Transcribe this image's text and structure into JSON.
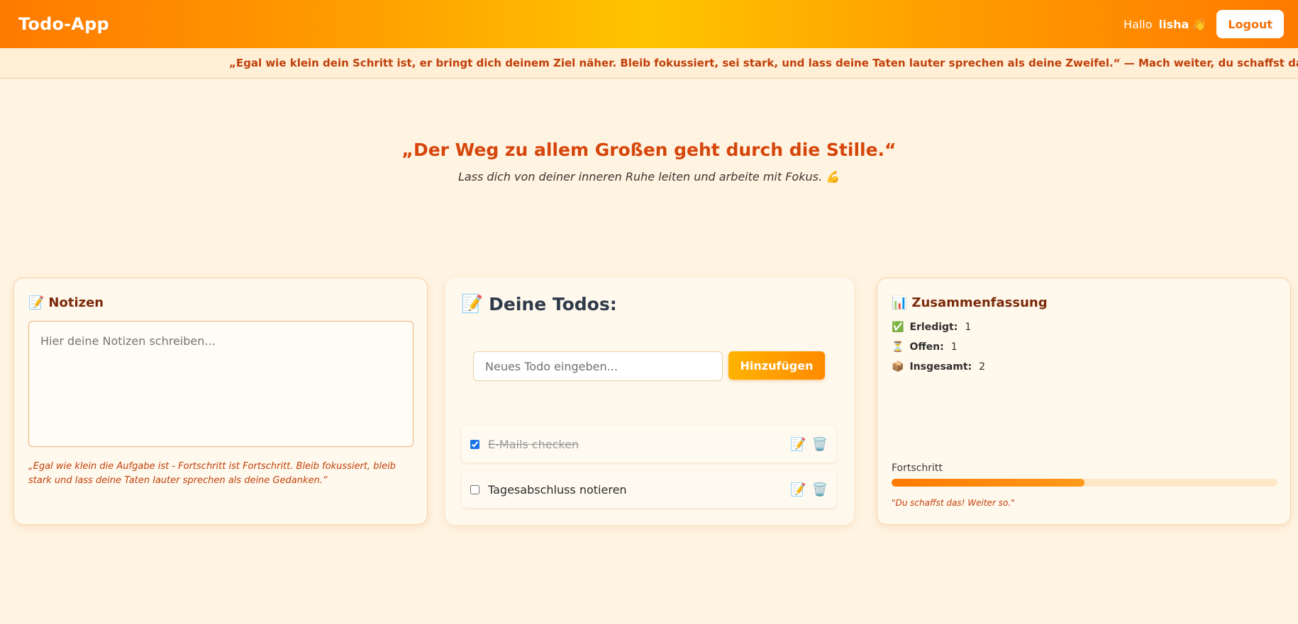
{
  "header": {
    "brand": "Todo-App",
    "greeting": "Hallo",
    "username": "lisha",
    "wave_emoji": "👋",
    "logout_label": "Logout"
  },
  "ticker": {
    "text": "„Egal wie klein dein Schritt ist, er bringt dich deinem Ziel näher. Bleib fokussiert, sei stark, und lass deine Taten lauter sprechen als deine Zweifel.“ — Mach weiter, du schaffst das!"
  },
  "hero": {
    "quote": "„Der Weg zu allem Großen geht durch die Stille.“",
    "subtitle": "Lass dich von deiner inneren Ruhe leiten und arbeite mit Fokus. 💪"
  },
  "notes": {
    "icon": "📝",
    "title": "Notizen",
    "placeholder": "Hier deine Notizen schreiben...",
    "quote": "„Egal wie klein die Aufgabe ist - Fortschritt ist Fortschritt. Bleib fokussiert, bleib stark und lass deine Taten lauter sprechen als deine Gedanken.“"
  },
  "todos": {
    "icon": "📝",
    "title": "Deine Todos:",
    "input_placeholder": "Neues Todo eingeben...",
    "add_label": "Hinzufügen",
    "items": [
      {
        "text": "E-Mails checken",
        "done": true,
        "edit_icon": "📝",
        "delete_icon": "🗑️"
      },
      {
        "text": "Tagesabschluss notieren",
        "done": false,
        "edit_icon": "📝",
        "delete_icon": "🗑️"
      }
    ]
  },
  "summary": {
    "icon": "📊",
    "title": "Zusammenfassung",
    "stats": [
      {
        "icon": "✅",
        "label": "Erledigt:",
        "value": "1"
      },
      {
        "icon": "⏳",
        "label": "Offen:",
        "value": "1"
      },
      {
        "icon": "📦",
        "label": "Insgesamt:",
        "value": "2"
      }
    ],
    "progress_label": "Fortschritt",
    "progress_fraction": 0.5,
    "progress_quote": "\"Du schaffst das! Weiter so.\""
  },
  "colors": {
    "accent": "#ff7a00",
    "accent_text": "#c0400a",
    "background": "#fff3e1"
  }
}
